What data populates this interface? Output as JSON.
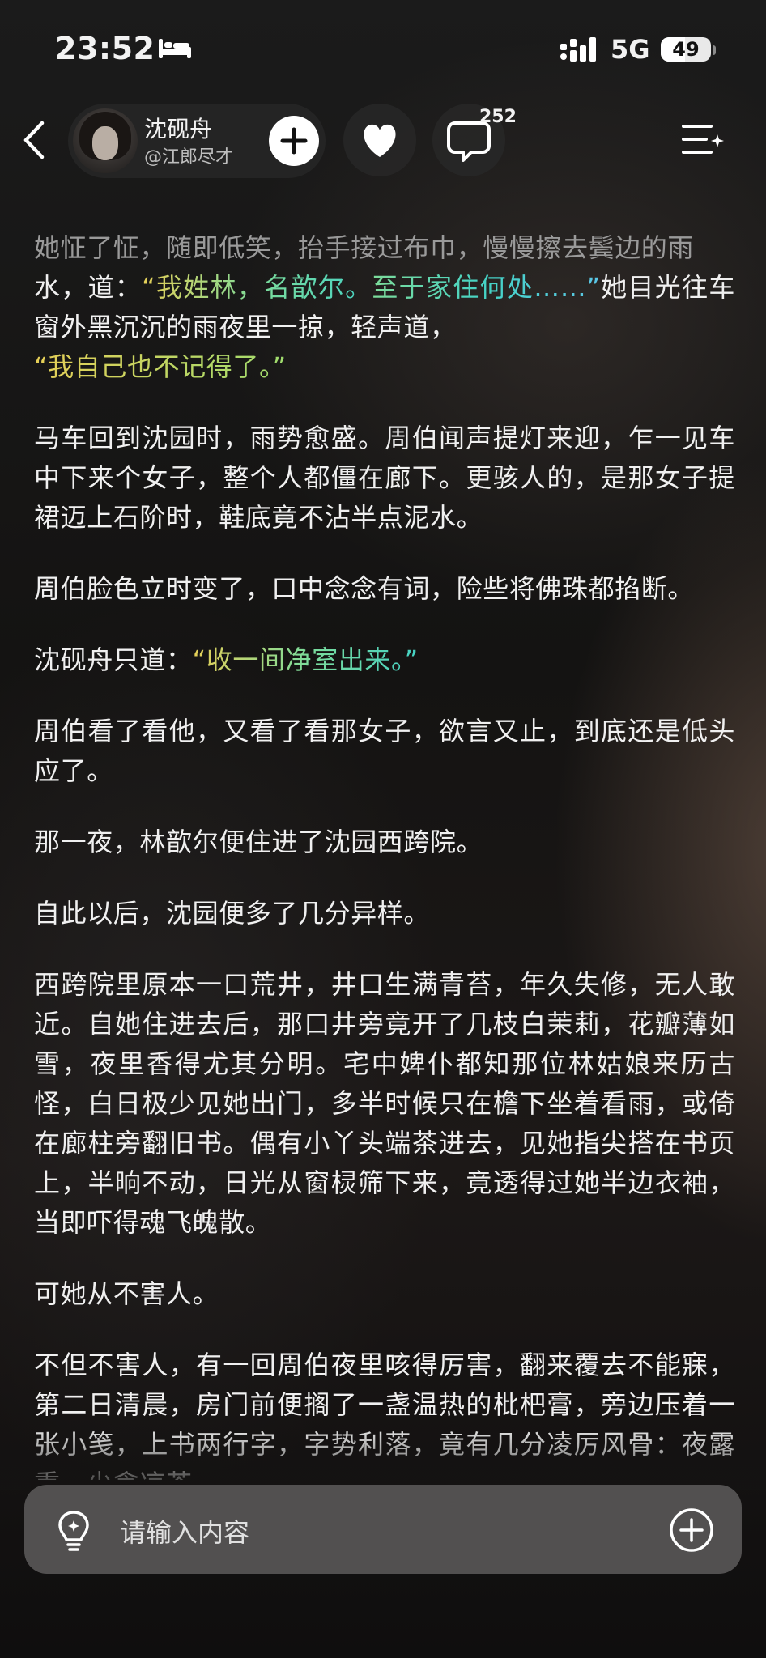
{
  "status_bar": {
    "time": "23:52",
    "network": "5G",
    "battery_level": "49",
    "battery_fraction": 0.49
  },
  "header": {
    "author_name": "沈砚舟",
    "author_handle": "@江郎尽才",
    "comment_count": "252",
    "icons": [
      "back-icon",
      "plus-icon",
      "heart-icon",
      "comment-icon",
      "list-menu-icon"
    ]
  },
  "content": {
    "p1_line1": "她怔了怔，随即低笑，抬手接过布巾，慢慢擦去鬓边的雨",
    "p1_pre": "水，道：",
    "p1_quote_a": "“我姓林，名歆尔。",
    "p1_quote_b": "至于家住何处……”",
    "p1_post": "她目光往车窗外黑沉沉的雨夜里一掠，轻声道，",
    "p1_quote_c": "“我自己也不记得了。”",
    "p2": "马车回到沈园时，雨势愈盛。周伯闻声提灯来迎，乍一见车中下来个女子，整个人都僵在廊下。更骇人的，是那女子提裙迈上石阶时，鞋底竟不沾半点泥水。",
    "p3": "周伯脸色立时变了，口中念念有词，险些将佛珠都掐断。",
    "p4_pre": "沈砚舟只道：",
    "p4_quote": "“收一间净室出来。”",
    "p5": "周伯看了看他，又看了看那女子，欲言又止，到底还是低头应了。",
    "p6": "那一夜，林歆尔便住进了沈园西跨院。",
    "p7": "自此以后，沈园便多了几分异样。",
    "p8": "西跨院里原本一口荒井，井口生满青苔，年久失修，无人敢近。自她住进去后，那口井旁竟开了几枝白茉莉，花瓣薄如雪，夜里香得尤其分明。宅中婢仆都知那位林姑娘来历古怪，白日极少见她出门，多半时候只在檐下坐着看雨，或倚在廊柱旁翻旧书。偶有小丫头端茶进去，见她指尖搭在书页上，半晌不动，日光从窗棂筛下来，竟透得过她半边衣袖，当即吓得魂飞魄散。",
    "p9": "可她从不害人。",
    "p10": "不但不害人，有一回周伯夜里咳得厉害，翻来覆去不能寐，第二日清晨，房门前便搁了一盏温热的枇杷膏，旁边压着一张小笺，上书两行字，字势利落，竟有几分凌厉风骨：夜露重，少贪凉茶。"
  },
  "input_bar": {
    "placeholder": "请输入内容",
    "icons": [
      "lightbulb-icon",
      "plus-circle-icon"
    ]
  },
  "colors": {
    "quote_yellow": "#e6cf57",
    "quote_green": "#7ddc9a",
    "quote_cyan": "#45d3c6",
    "text": "#f0f0f0",
    "faded_text": "#9a9a9a"
  }
}
